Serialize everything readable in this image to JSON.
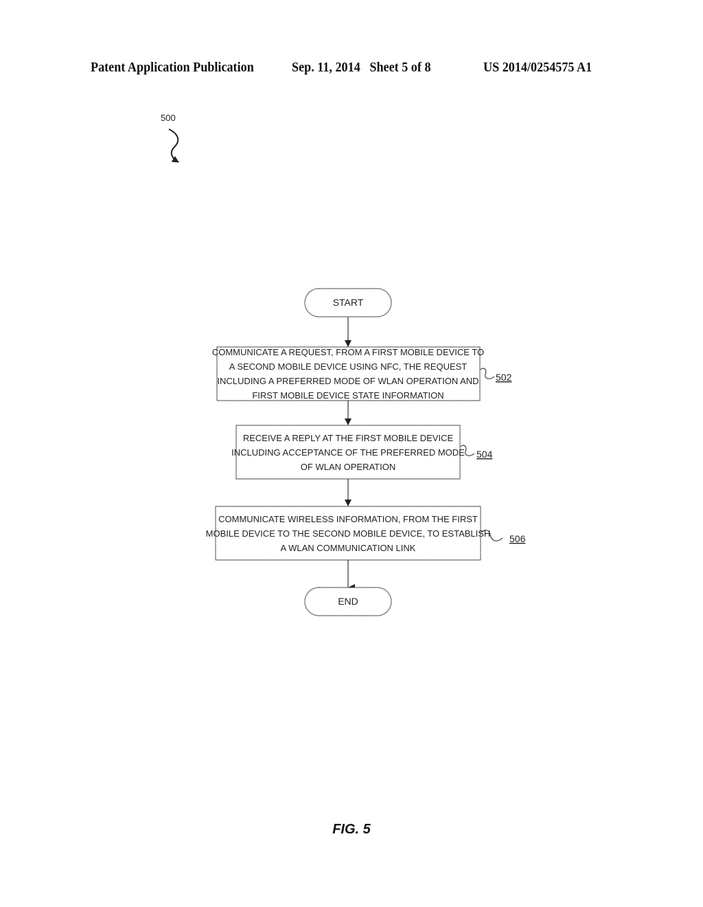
{
  "header": {
    "left": "Patent Application Publication",
    "middle": "Sep. 11, 2014   Sheet 5 of 8",
    "right": "US 2014/0254575 A1"
  },
  "figure": {
    "reference": "500",
    "caption": "FIG. 5",
    "start_label": "START",
    "end_label": "END",
    "steps": [
      {
        "ref": "502",
        "lines": [
          "COMMUNICATE A REQUEST, FROM A FIRST MOBILE DEVICE TO",
          "A SECOND MOBILE DEVICE USING NFC, THE REQUEST",
          "INCLUDING A PREFERRED MODE OF WLAN OPERATION AND",
          "FIRST MOBILE DEVICE STATE INFORMATION"
        ]
      },
      {
        "ref": "504",
        "lines": [
          "RECEIVE A REPLY AT THE FIRST MOBILE DEVICE",
          "INCLUDING ACCEPTANCE OF THE PREFERRED MODE",
          "OF WLAN OPERATION"
        ]
      },
      {
        "ref": "506",
        "lines": [
          "COMMUNICATE WIRELESS INFORMATION, FROM THE FIRST",
          "MOBILE DEVICE TO THE SECOND MOBILE DEVICE, TO ESTABLISH",
          "A WLAN COMMUNICATION LINK"
        ]
      }
    ],
    "colors": {
      "ink": "#222222",
      "background": "#ffffff"
    }
  }
}
